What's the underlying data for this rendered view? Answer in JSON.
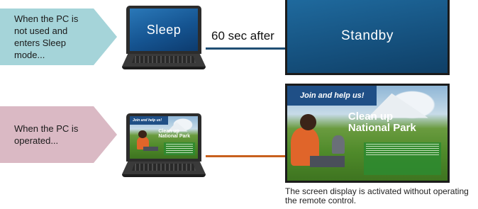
{
  "callouts": {
    "sleep": "When the PC is not used and enters Sleep mode...",
    "operated": "When the PC is operated..."
  },
  "laptop_sleep": {
    "label": "Sleep"
  },
  "connector": {
    "label": "60 sec after"
  },
  "display_standby": {
    "label": "Standby"
  },
  "poster": {
    "banner": "Join and help us!",
    "title_line1": "Clean up",
    "title_line2": "National Park"
  },
  "caption": "The screen display is activated without operating the remote control.",
  "colors": {
    "teal_callout": "#a5d4d9",
    "rose_callout": "#dab9c4",
    "blue_line": "#1f4f74",
    "orange_line": "#c8601e",
    "screen_blue": "#15507d"
  }
}
